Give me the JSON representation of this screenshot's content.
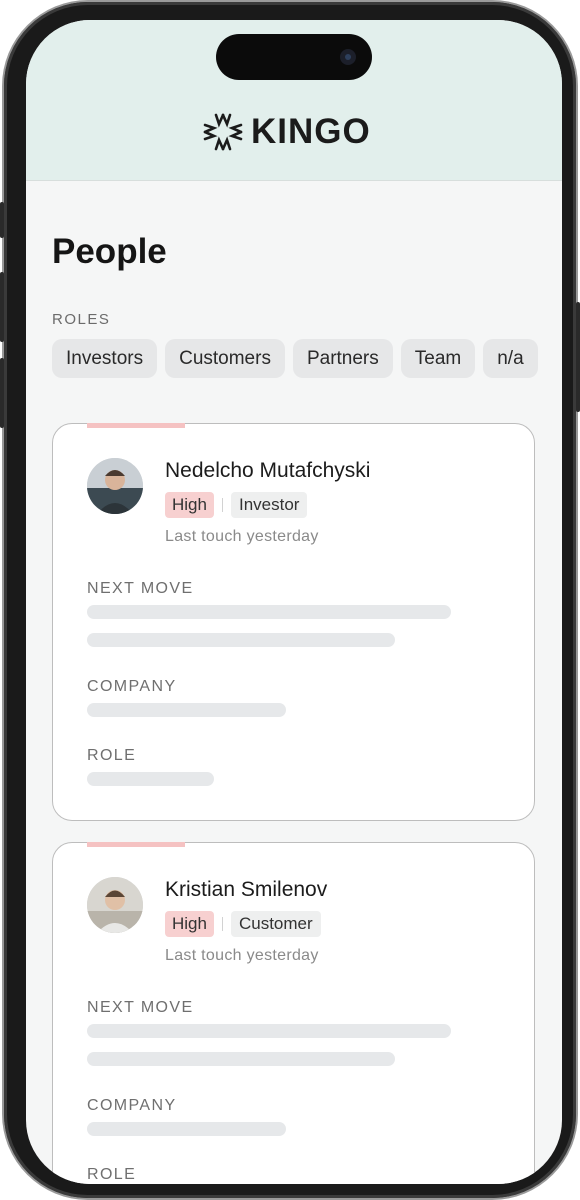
{
  "app": {
    "brand": "KINGO"
  },
  "page": {
    "title": "People"
  },
  "roles": {
    "label": "ROLES",
    "items": [
      "Investors",
      "Customers",
      "Partners",
      "Team",
      "n/a"
    ]
  },
  "people": [
    {
      "name": "Nedelcho Mutafchyski",
      "priority": "High",
      "role_tag": "Investor",
      "last_touch": "Last touch yesterday",
      "next_move_label": "NEXT MOVE",
      "company_label": "COMPANY",
      "role_label": "ROLE"
    },
    {
      "name": "Kristian Smilenov",
      "priority": "High",
      "role_tag": "Customer",
      "last_touch": "Last touch yesterday",
      "next_move_label": "NEXT MOVE",
      "company_label": "COMPANY",
      "role_label": "ROLE"
    }
  ],
  "colors": {
    "header_bg": "#e2efec",
    "priority_high_bg": "#f7d0d0",
    "card_accent": "#f5c2c2"
  },
  "icons": {
    "logo": "kingo-burst-logo"
  }
}
